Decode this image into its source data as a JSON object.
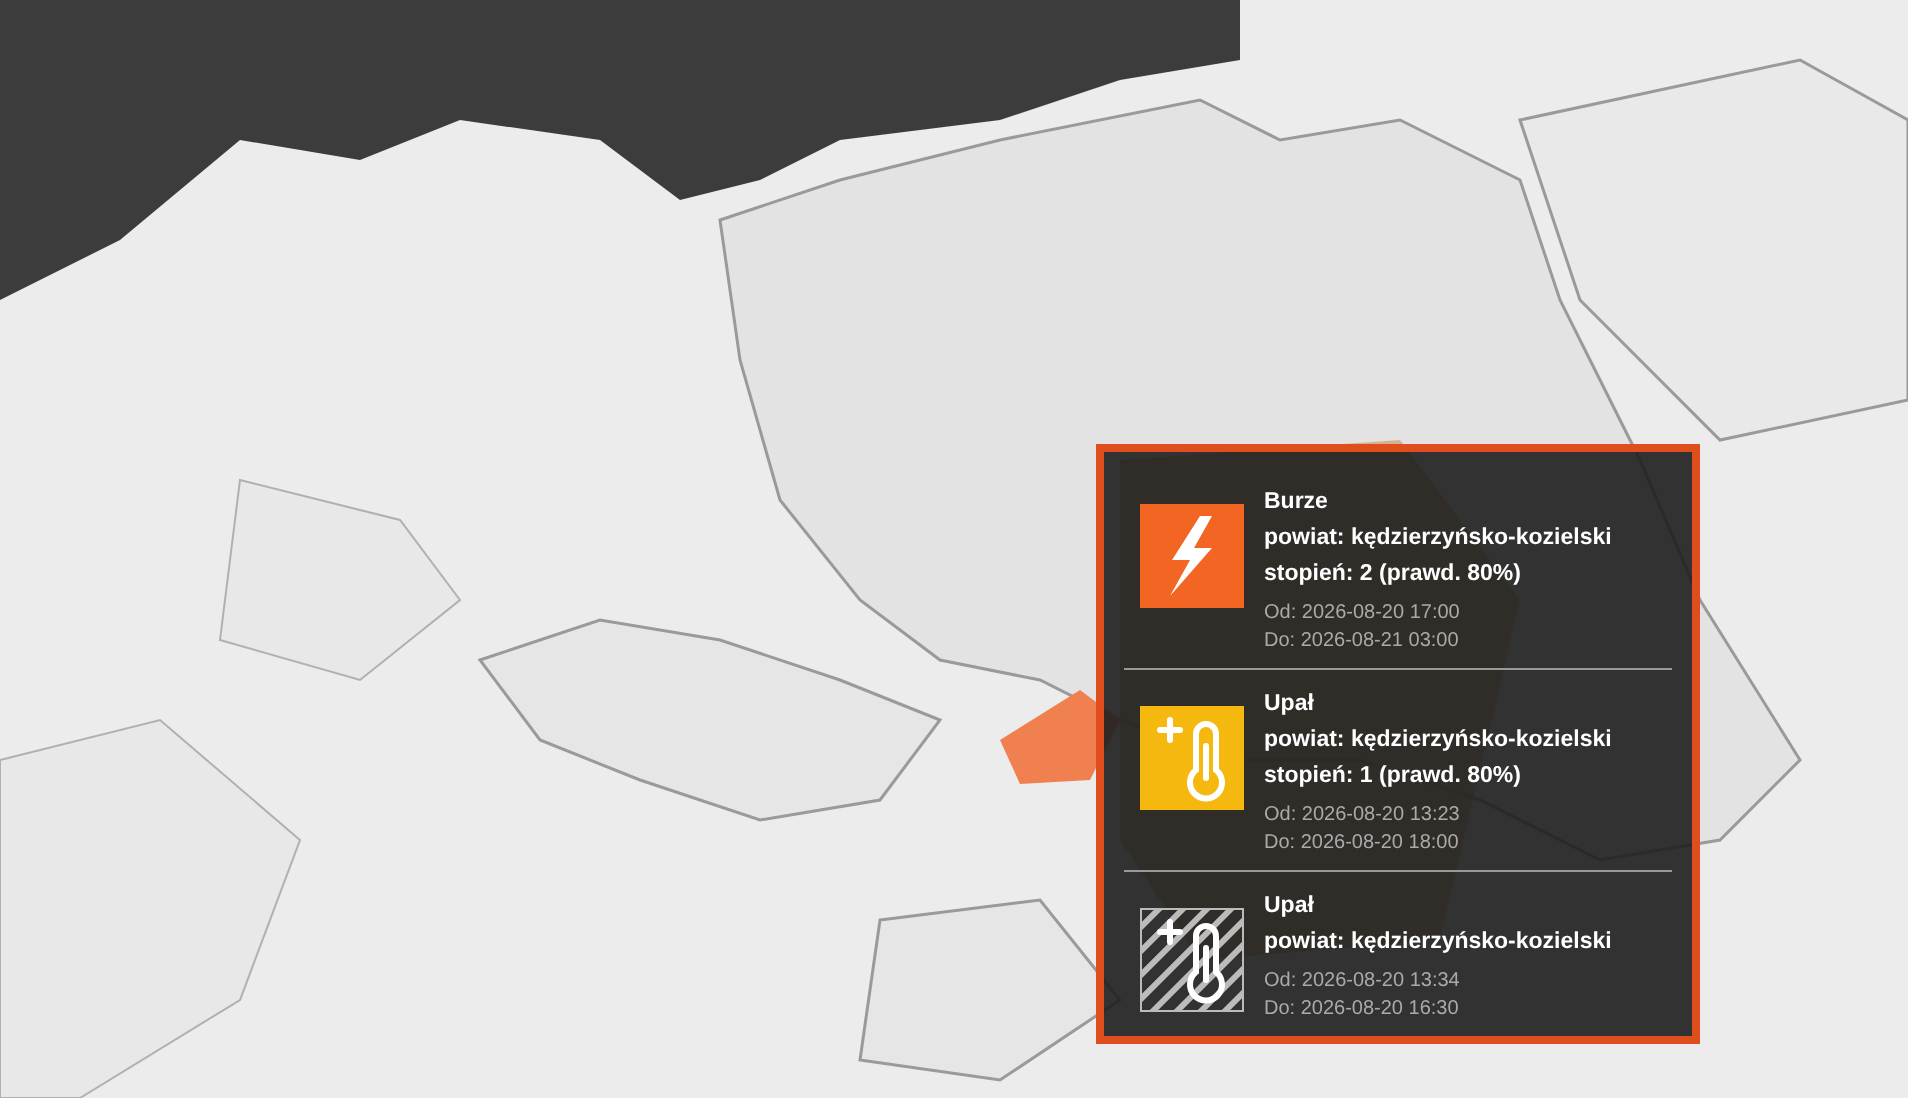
{
  "popup": {
    "warnings": [
      {
        "kind": "storm",
        "hatched": false,
        "color": "#f26522",
        "title": "Burze",
        "district": "powiat: kędzierzyńsko-kozielski",
        "degree": "stopień: 2 (prawd. 80%)",
        "from": "Od: 2026-08-20 17:00",
        "to": "Do: 2026-08-21 03:00"
      },
      {
        "kind": "heat",
        "hatched": false,
        "color": "#f5b80f",
        "title": "Upał",
        "district": "powiat: kędzierzyńsko-kozielski",
        "degree": "stopień: 1 (prawd. 80%)",
        "from": "Od: 2026-08-20 13:23",
        "to": "Do: 2026-08-20 18:00"
      },
      {
        "kind": "heat",
        "hatched": true,
        "title": "Upał",
        "district": "powiat: kędzierzyńsko-kozielski",
        "from": "Od: 2026-08-20 13:34",
        "to": "Do: 2026-08-20 16:30"
      }
    ]
  }
}
